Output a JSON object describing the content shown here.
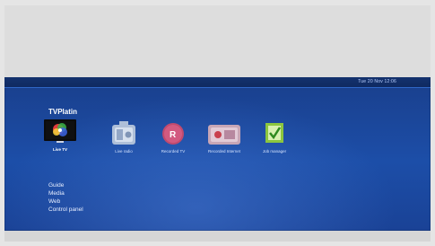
{
  "statusbar": {
    "clock": "Tue 20 Nov 12:06"
  },
  "app": {
    "title": "TVPlatin"
  },
  "tiles": [
    {
      "label": "Live TV",
      "icon": "tv-icon"
    },
    {
      "label": "Live radio",
      "icon": "radio-icon"
    },
    {
      "label": "Recorded TV",
      "icon": "record-icon"
    },
    {
      "label": "Recorded Internet",
      "icon": "internet-radio-icon"
    },
    {
      "label": "Job manager",
      "icon": "checkbox-icon"
    }
  ],
  "menu": [
    "Guide",
    "Media",
    "Web",
    "Control panel"
  ]
}
